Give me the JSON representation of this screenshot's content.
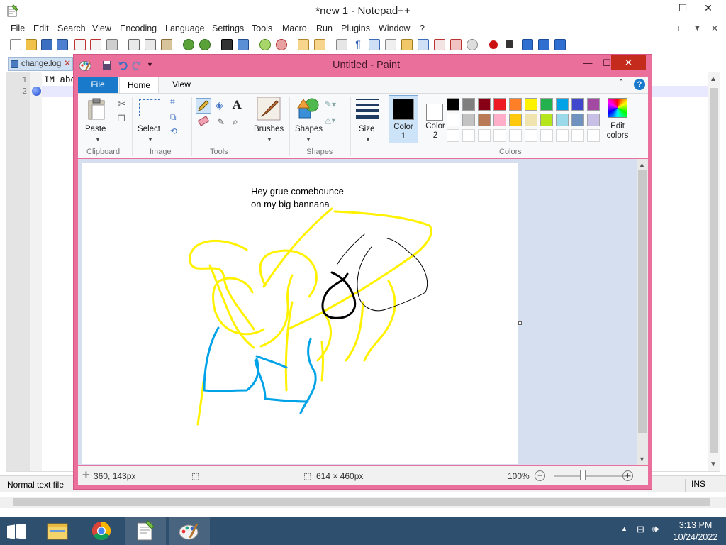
{
  "notepad": {
    "title": "*new 1 - Notepad++",
    "menu": [
      "File",
      "Edit",
      "Search",
      "View",
      "Encoding",
      "Language",
      "Settings",
      "Tools",
      "Macro",
      "Run",
      "Plugins",
      "Window",
      "?"
    ],
    "menu_right": [
      "+",
      "▼",
      "✕"
    ],
    "controls": [
      "—",
      "☐",
      "✕"
    ],
    "tab": "change.log",
    "tab_close": "✕",
    "line_numbers": [
      "1",
      "2"
    ],
    "line1_text": "IM abo",
    "status_left": "Normal text file",
    "status_ins": "INS"
  },
  "paint": {
    "title": "Untitled - Paint",
    "controls": [
      "—",
      "☐",
      "✕"
    ],
    "tabs": [
      "File",
      "Home",
      "View"
    ],
    "help": "?",
    "buttons": {
      "paste": "Paste",
      "select": "Select",
      "brushes": "Brushes",
      "shapes": "Shapes",
      "size": "Size",
      "color1": "Color\n1",
      "color2": "Color\n2",
      "edit_colors": "Edit\ncolors"
    },
    "group_labels": [
      "Clipboard",
      "Image",
      "Tools",
      "Shapes",
      "Colors"
    ],
    "palette_row1": [
      "#000000",
      "#7f7f7f",
      "#880015",
      "#ed1c24",
      "#ff7f27",
      "#fff200",
      "#22b14c",
      "#00a2e8",
      "#3f48cc",
      "#a349a4"
    ],
    "palette_row2": [
      "#ffffff",
      "#c3c3c3",
      "#b97a57",
      "#ffaec9",
      "#ffc90e",
      "#efe4b0",
      "#b5e61d",
      "#99d9ea",
      "#7092be",
      "#c8bfe7"
    ],
    "color1_value": "#000000",
    "color2_value": "#ffffff",
    "canvas_text_line1": "Hey grue comebounce",
    "canvas_text_line2": "on my big bannana",
    "status": {
      "cursor": "360, 143px",
      "size": "614 × 460px",
      "zoom": "100%"
    }
  },
  "taskbar": {
    "apps": [
      "file-explorer",
      "chrome",
      "notepad-plus-plus",
      "paint"
    ],
    "time": "3:13 PM",
    "date": "10/24/2022"
  }
}
